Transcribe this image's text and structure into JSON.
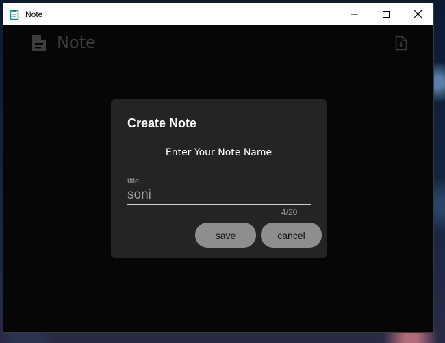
{
  "window": {
    "title": "Note",
    "controls": [
      "minimize",
      "maximize",
      "close"
    ]
  },
  "app_bar": {
    "title": "Note",
    "left_icon": "document-icon",
    "right_icon": "new-note-icon"
  },
  "dialog": {
    "title": "Create Note",
    "subtitle": "Enter Your Note Name",
    "field": {
      "label": "title",
      "value": "soni",
      "counter": "4/20"
    },
    "save_label": "save",
    "cancel_label": "cancel"
  },
  "colors": {
    "window_bg": "#060606",
    "dialog_bg": "#242424",
    "button_bg": "#8e8e8e",
    "muted_text": "#3d3d3d"
  }
}
